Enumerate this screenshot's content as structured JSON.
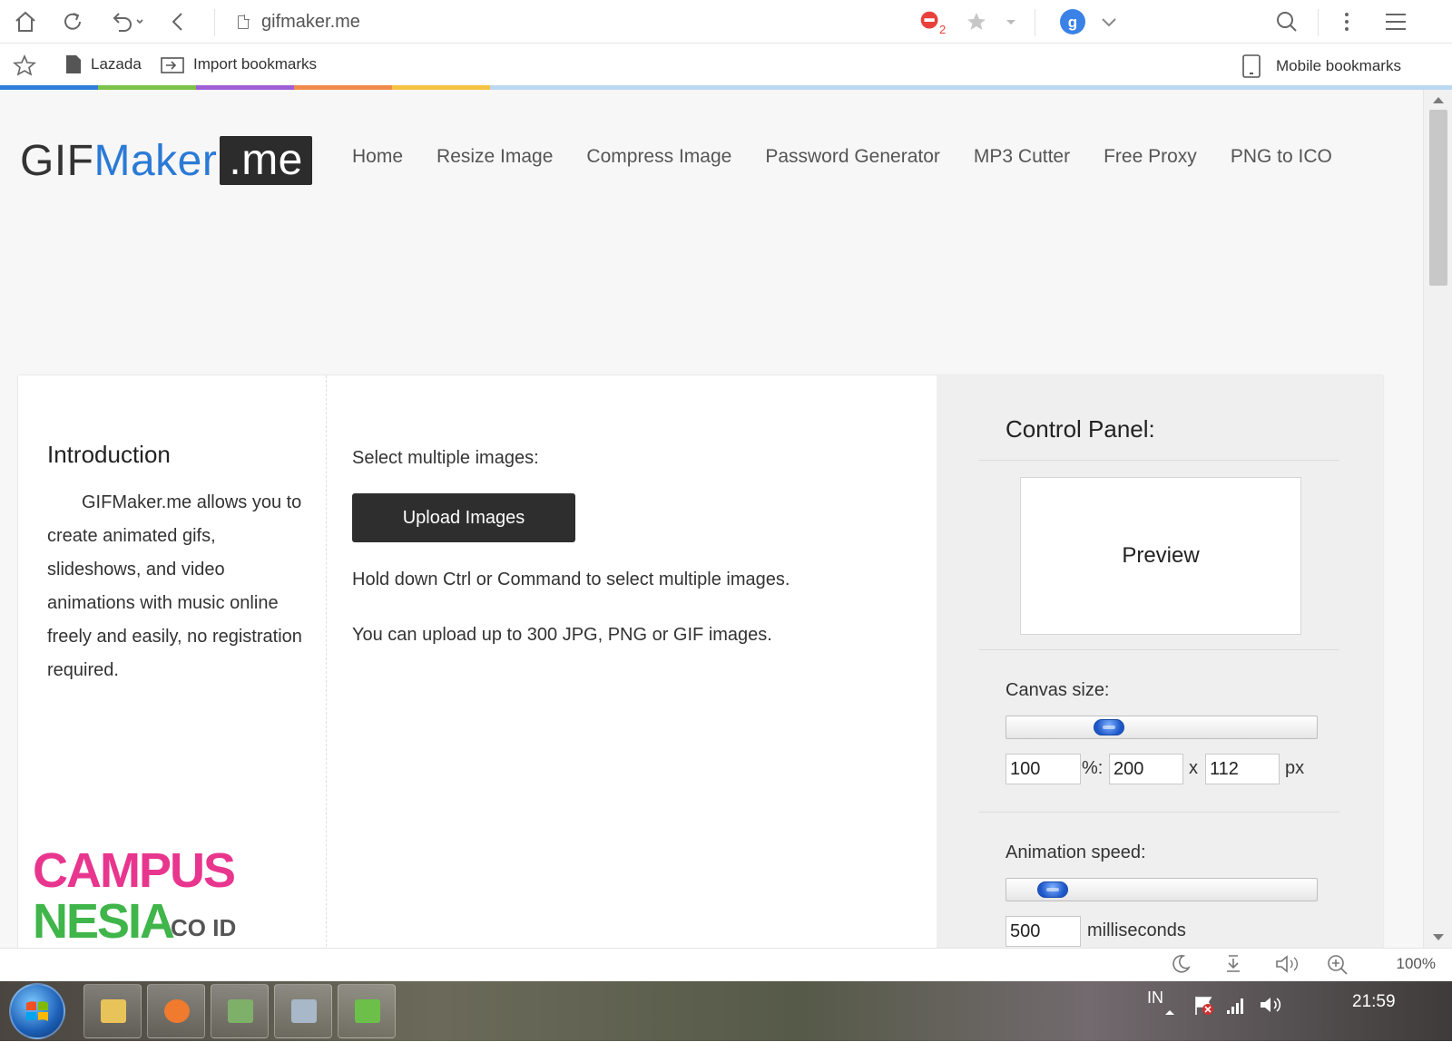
{
  "browser": {
    "address": "gifmaker.me",
    "notification_count": "2",
    "bookmarks": [
      "Lazada",
      "Import bookmarks"
    ],
    "mobile_bookmarks": "Mobile bookmarks",
    "zoom": "100%"
  },
  "site": {
    "logo": {
      "part1": "GIF",
      "part2": "Maker",
      "part3": ".me"
    },
    "nav": [
      "Home",
      "Resize Image",
      "Compress Image",
      "Password Generator",
      "MP3 Cutter",
      "Free Proxy",
      "PNG to ICO"
    ]
  },
  "intro": {
    "heading": "Introduction",
    "text": "GIFMaker.me allows you to create animated gifs, slideshows, and video animations with music online freely and easily, no registration required."
  },
  "upload": {
    "prompt": "Select multiple images:",
    "button": "Upload Images",
    "hint1": "Hold down Ctrl or Command to select multiple images.",
    "hint2": "You can upload up to 300 JPG, PNG or GIF images."
  },
  "control_panel": {
    "title": "Control Panel:",
    "preview": "Preview",
    "canvas_label": "Canvas size:",
    "canvas_slider_fraction": 0.28,
    "canvas_percent": "100",
    "percent_sep": "%:",
    "canvas_width": "200",
    "x_sep": "x",
    "canvas_height": "112",
    "px_unit": "px",
    "speed_label": "Animation speed:",
    "speed_slider_fraction": 0.1,
    "speed_value": "500",
    "speed_unit": "milliseconds"
  },
  "watermark": {
    "line1": "CAMPUS",
    "line2": "NESIA",
    "suffix": "CO ID"
  },
  "taskbar": {
    "lang": "IN",
    "time": "21:59"
  },
  "colors": {
    "accent_blue": "#2b7ad6",
    "button_dark": "#2e2e2e"
  }
}
